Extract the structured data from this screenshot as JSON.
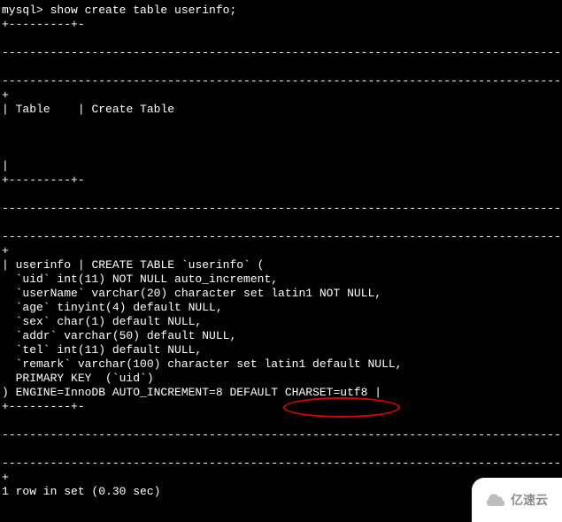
{
  "terminal": {
    "prompt": "mysql> ",
    "command": "show create table userinfo;",
    "border_short_top": "+---------+-",
    "border_empty1": "",
    "dash_line": "-------------------------------------------------------------------------------------------------------",
    "border_plus": "+",
    "header_sep": "| ",
    "header_table": "Table   ",
    "header_sep2": " | ",
    "header_create": "Create Table",
    "pipe_only": "|",
    "row_sep": "| ",
    "row_table": "userinfo",
    "row_sep2": " | ",
    "row_create": "CREATE TABLE `userinfo` (",
    "def1": "  `uid` int(11) NOT NULL auto_increment,",
    "def2": "  `userName` varchar(20) character set latin1 NOT NULL,",
    "def3": "  `age` tinyint(4) default NULL,",
    "def4": "  `sex` char(1) default NULL,",
    "def5": "  `addr` varchar(50) default NULL,",
    "def6": "  `tel` int(11) default NULL,",
    "def7": "  `remark` varchar(100) character set latin1 default NULL,",
    "def8": "  PRIMARY KEY  (`uid`)",
    "def9_pre": ") ENGINE=InnoDB AUTO_INCREMENT=8 DEFAULT ",
    "def9_hl": "CHARSET=utf8",
    "def9_post": " |",
    "footer": "1 row in set (0.30 sec)",
    "blank": ""
  },
  "watermark": {
    "text": "亿速云"
  }
}
